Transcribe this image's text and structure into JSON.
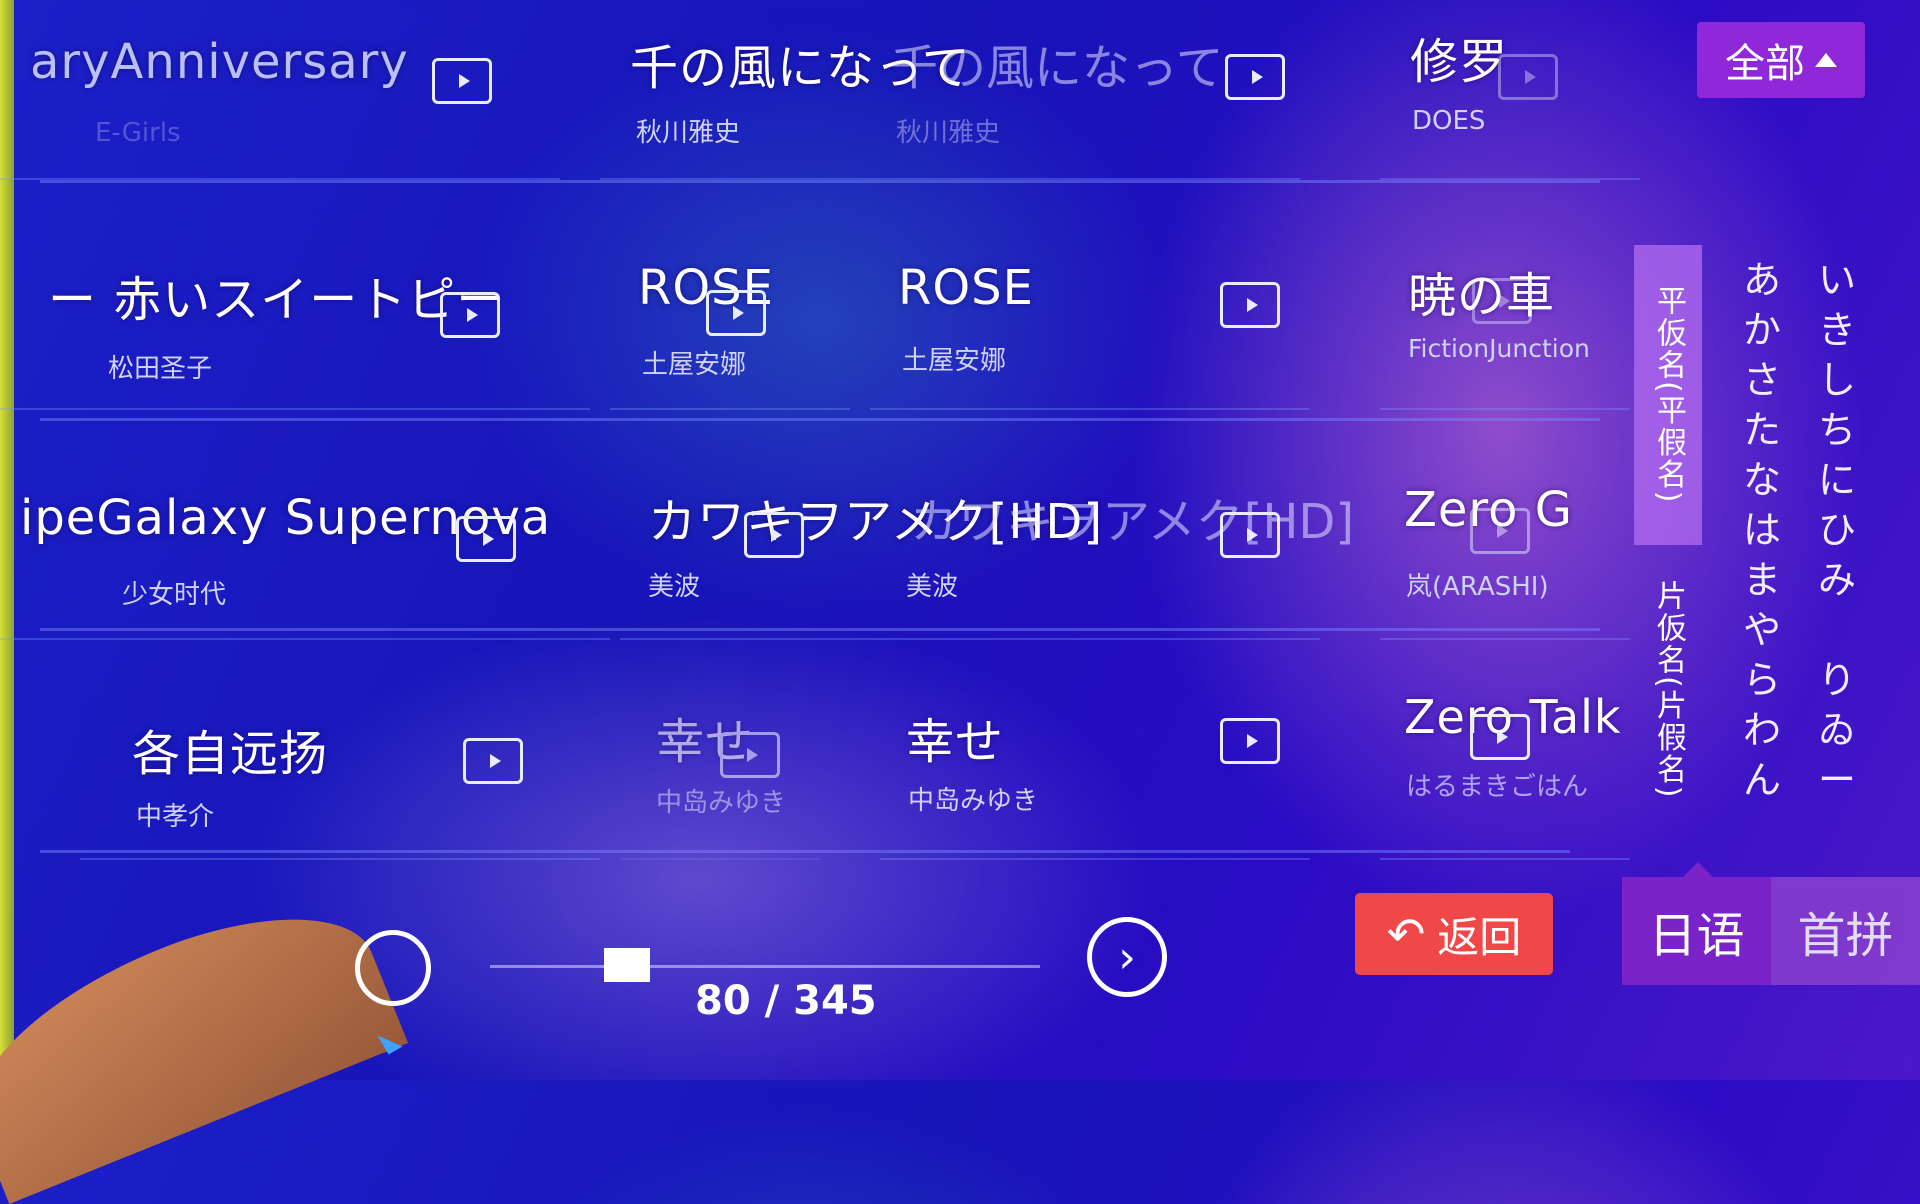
{
  "songs": [
    {
      "title": "aryAnniversary",
      "artist": "E-Girls"
    },
    {
      "title": "千の風になって",
      "artist": "秋川雅史",
      "ghost_title": "千の風になって",
      "ghost_artist": "秋川雅史"
    },
    {
      "title": "修罗",
      "artist": "DOES"
    },
    {
      "title": "ー 赤いスイートピー",
      "artist": "松田圣子"
    },
    {
      "title": "ROSE",
      "artist": "土屋安娜"
    },
    {
      "title": "ROSE",
      "artist": "土屋安娜"
    },
    {
      "title": "暁の車",
      "artist": "FictionJunction"
    },
    {
      "title": "ipeGalaxy Supernova",
      "artist": "少女时代"
    },
    {
      "title": "カワキヲアメク[HD]",
      "artist": "美波",
      "ghost_title": "カワキヲアメク[HD]"
    },
    {
      "title": "Zero G",
      "artist": "岚(ARASHI)"
    },
    {
      "title": "各自远扬",
      "artist": "中孝介"
    },
    {
      "title": "幸せ",
      "artist": "中岛みゆき"
    },
    {
      "title": "幸せ",
      "artist": "中岛みゆき"
    },
    {
      "title": "Zero Talk",
      "artist": "はるまきごはん"
    }
  ],
  "filter": {
    "label": "全部"
  },
  "index": {
    "hiragana_tab": "平仮名(平假名)",
    "katakana_tab": "片仮名(片假名)",
    "kana_col1": [
      "あ",
      "か",
      "さ",
      "た",
      "な",
      "は",
      "ま",
      "や",
      "ら",
      "わ",
      "ん"
    ],
    "kana_col2": [
      "い",
      "き",
      "し",
      "ち",
      "に",
      "ひ",
      "み",
      "",
      "り",
      "ゐ",
      "ー"
    ]
  },
  "footer": {
    "back_label": "返回",
    "tab_japanese": "日语",
    "tab_initials": "首拼",
    "page_indicator": "80 / 345",
    "page_current": 80,
    "page_total": 345
  },
  "colors": {
    "accent": "#8f28d8",
    "back": "#f04848",
    "bg": "#1c20c8"
  }
}
